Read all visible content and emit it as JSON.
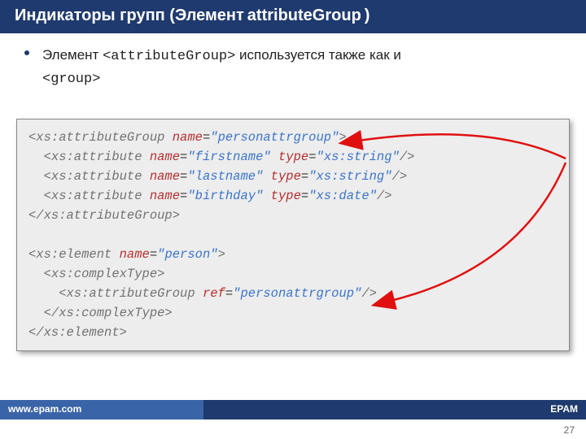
{
  "title": {
    "main": "Индикаторы групп (Элемент ",
    "elem": "attributeGroup",
    "close": ")"
  },
  "bullet": {
    "t1": "Элемент ",
    "code1": "<attributeGroup>",
    "t2": " используется также как и ",
    "code2": "<group>"
  },
  "code": {
    "l1a": "<xs:attributeGroup",
    "l1n": " name",
    "l1e": "=",
    "l1v": "\"personattrgroup\"",
    "l1c": ">",
    "l2a": "  <xs:attribute",
    "l2n": " name",
    "l2e": "=",
    "l2v": "\"firstname\"",
    "l2t": " type",
    "l2te": "=",
    "l2tv": "\"xs:string\"",
    "l2c": "/>",
    "l3a": "  <xs:attribute",
    "l3n": " name",
    "l3e": "=",
    "l3v": "\"lastname\"",
    "l3t": " type",
    "l3te": "=",
    "l3tv": "\"xs:string\"",
    "l3c": "/>",
    "l4a": "  <xs:attribute",
    "l4n": " name",
    "l4e": "=",
    "l4v": "\"birthday\"",
    "l4t": " type",
    "l4te": "=",
    "l4tv": "\"xs:date\"",
    "l4c": "/>",
    "l5": "</xs:attributeGroup>",
    "l6": " ",
    "l7a": "<xs:element",
    "l7n": " name",
    "l7e": "=",
    "l7v": "\"person\"",
    "l7c": ">",
    "l8": "  <xs:complexType>",
    "l9a": "    <xs:attributeGroup",
    "l9n": " ref",
    "l9e": "=",
    "l9v": "\"personattrgroup\"",
    "l9c": "/>",
    "l10": "  </xs:complexType>",
    "l11": "</xs:element>"
  },
  "footer": {
    "url": "www.epam.com",
    "brand": "EPAM"
  },
  "page": "27"
}
